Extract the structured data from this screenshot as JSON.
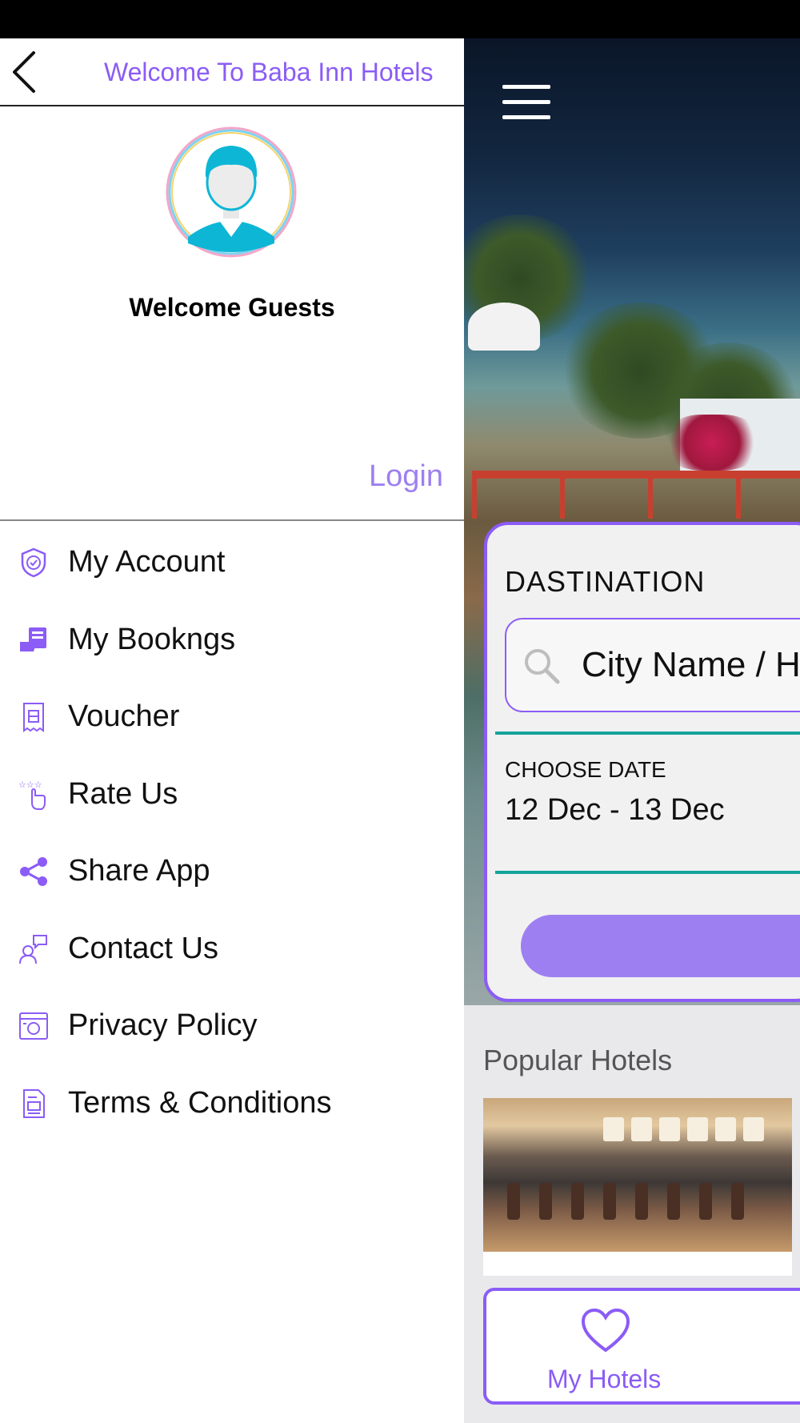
{
  "drawer": {
    "title": "Welcome To Baba Inn Hotels",
    "welcome_text": "Welcome Guests",
    "login_label": "Login",
    "menu_items": [
      {
        "label": "My Account",
        "icon": "shield-check-icon"
      },
      {
        "label": "My Bookngs",
        "icon": "bookings-icon"
      },
      {
        "label": "Voucher",
        "icon": "voucher-icon"
      },
      {
        "label": "Rate Us",
        "icon": "rate-stars-icon"
      },
      {
        "label": "Share App",
        "icon": "share-icon"
      },
      {
        "label": "Contact Us",
        "icon": "contact-support-icon"
      },
      {
        "label": "Privacy Policy",
        "icon": "privacy-policy-icon"
      },
      {
        "label": "Terms & Conditions",
        "icon": "terms-document-icon"
      }
    ]
  },
  "search": {
    "destination_label": "DASTINATION",
    "destination_value": "City Name / Hotel",
    "date_label": "CHOOSE DATE",
    "date_value": "12 Dec - 13 Dec"
  },
  "popular": {
    "title": "Popular Hotels"
  },
  "bottom": {
    "my_hotels_label": "My Hotels"
  },
  "colors": {
    "accent": "#8b5cf6",
    "accent_light": "#9d7ff2",
    "teal": "#14a39a"
  }
}
